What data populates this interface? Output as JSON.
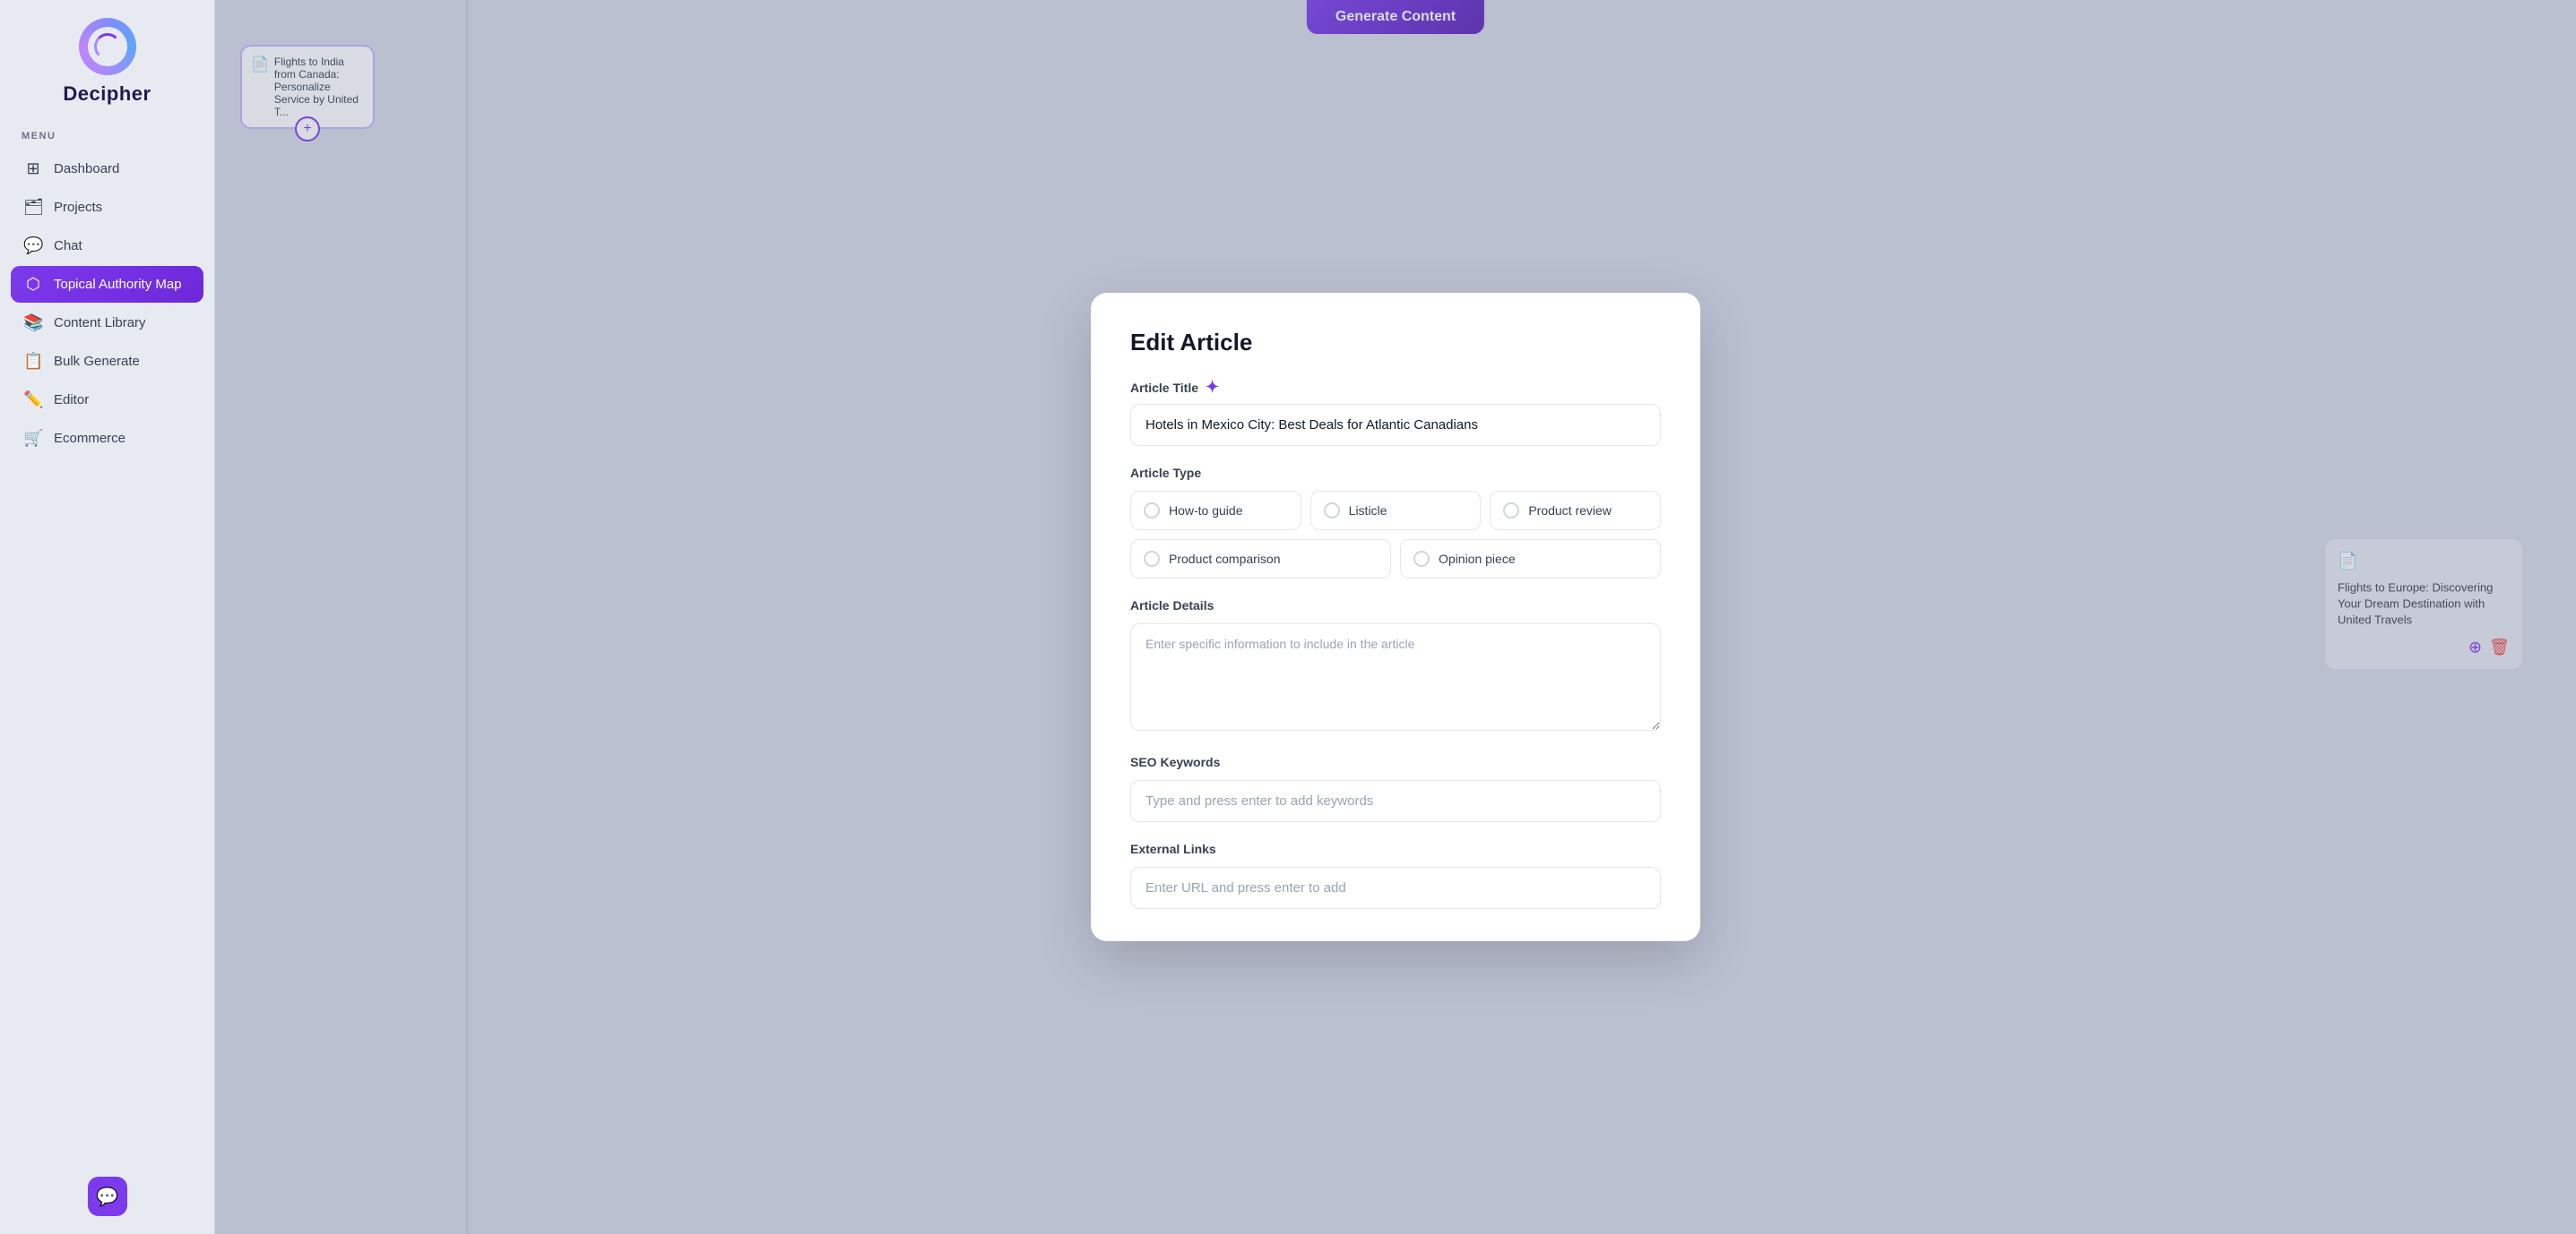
{
  "app": {
    "title": "Decipher",
    "logo_alt": "Decipher logo"
  },
  "sidebar": {
    "menu_label": "MENU",
    "items": [
      {
        "id": "dashboard",
        "label": "Dashboard",
        "icon": "⊞",
        "active": false
      },
      {
        "id": "projects",
        "label": "Projects",
        "icon": "🗂",
        "active": false
      },
      {
        "id": "chat",
        "label": "Chat",
        "icon": "💬",
        "active": false
      },
      {
        "id": "topical-authority-map",
        "label": "Topical Authority Map",
        "icon": "⬡",
        "active": true
      },
      {
        "id": "content-library",
        "label": "Content Library",
        "icon": "📚",
        "active": false
      },
      {
        "id": "bulk-generate",
        "label": "Bulk Generate",
        "icon": "📋",
        "active": false
      },
      {
        "id": "editor",
        "label": "Editor",
        "icon": "✏️",
        "active": false
      },
      {
        "id": "ecommerce",
        "label": "Ecommerce",
        "icon": "🛒",
        "active": false
      }
    ],
    "chat_btn_icon": "💬"
  },
  "header": {
    "generate_btn_label": "Generate Content"
  },
  "background": {
    "card_left_text": "",
    "card_right_title": "Flights to Europe: Discovering Your Dream Destination with United Travels"
  },
  "modal": {
    "title": "Edit Article",
    "article_title_label": "Article Title",
    "article_title_value": "Hotels in Mexico City: Best Deals for Atlantic Canadians",
    "article_type_label": "Article Type",
    "article_types": [
      {
        "id": "how-to-guide",
        "label": "How-to guide",
        "selected": false
      },
      {
        "id": "listicle",
        "label": "Listicle",
        "selected": false
      },
      {
        "id": "product-review",
        "label": "Product review",
        "selected": false
      },
      {
        "id": "product-comparison",
        "label": "Product comparison",
        "selected": false
      },
      {
        "id": "opinion-piece",
        "label": "Opinion piece",
        "selected": false
      }
    ],
    "article_details_label": "Article Details",
    "article_details_placeholder": "Enter specific information to include in the article",
    "seo_keywords_label": "SEO Keywords",
    "seo_keywords_placeholder": "Type and press enter to add keywords",
    "external_links_label": "External Links",
    "external_links_placeholder": "Enter URL and press enter to add"
  }
}
